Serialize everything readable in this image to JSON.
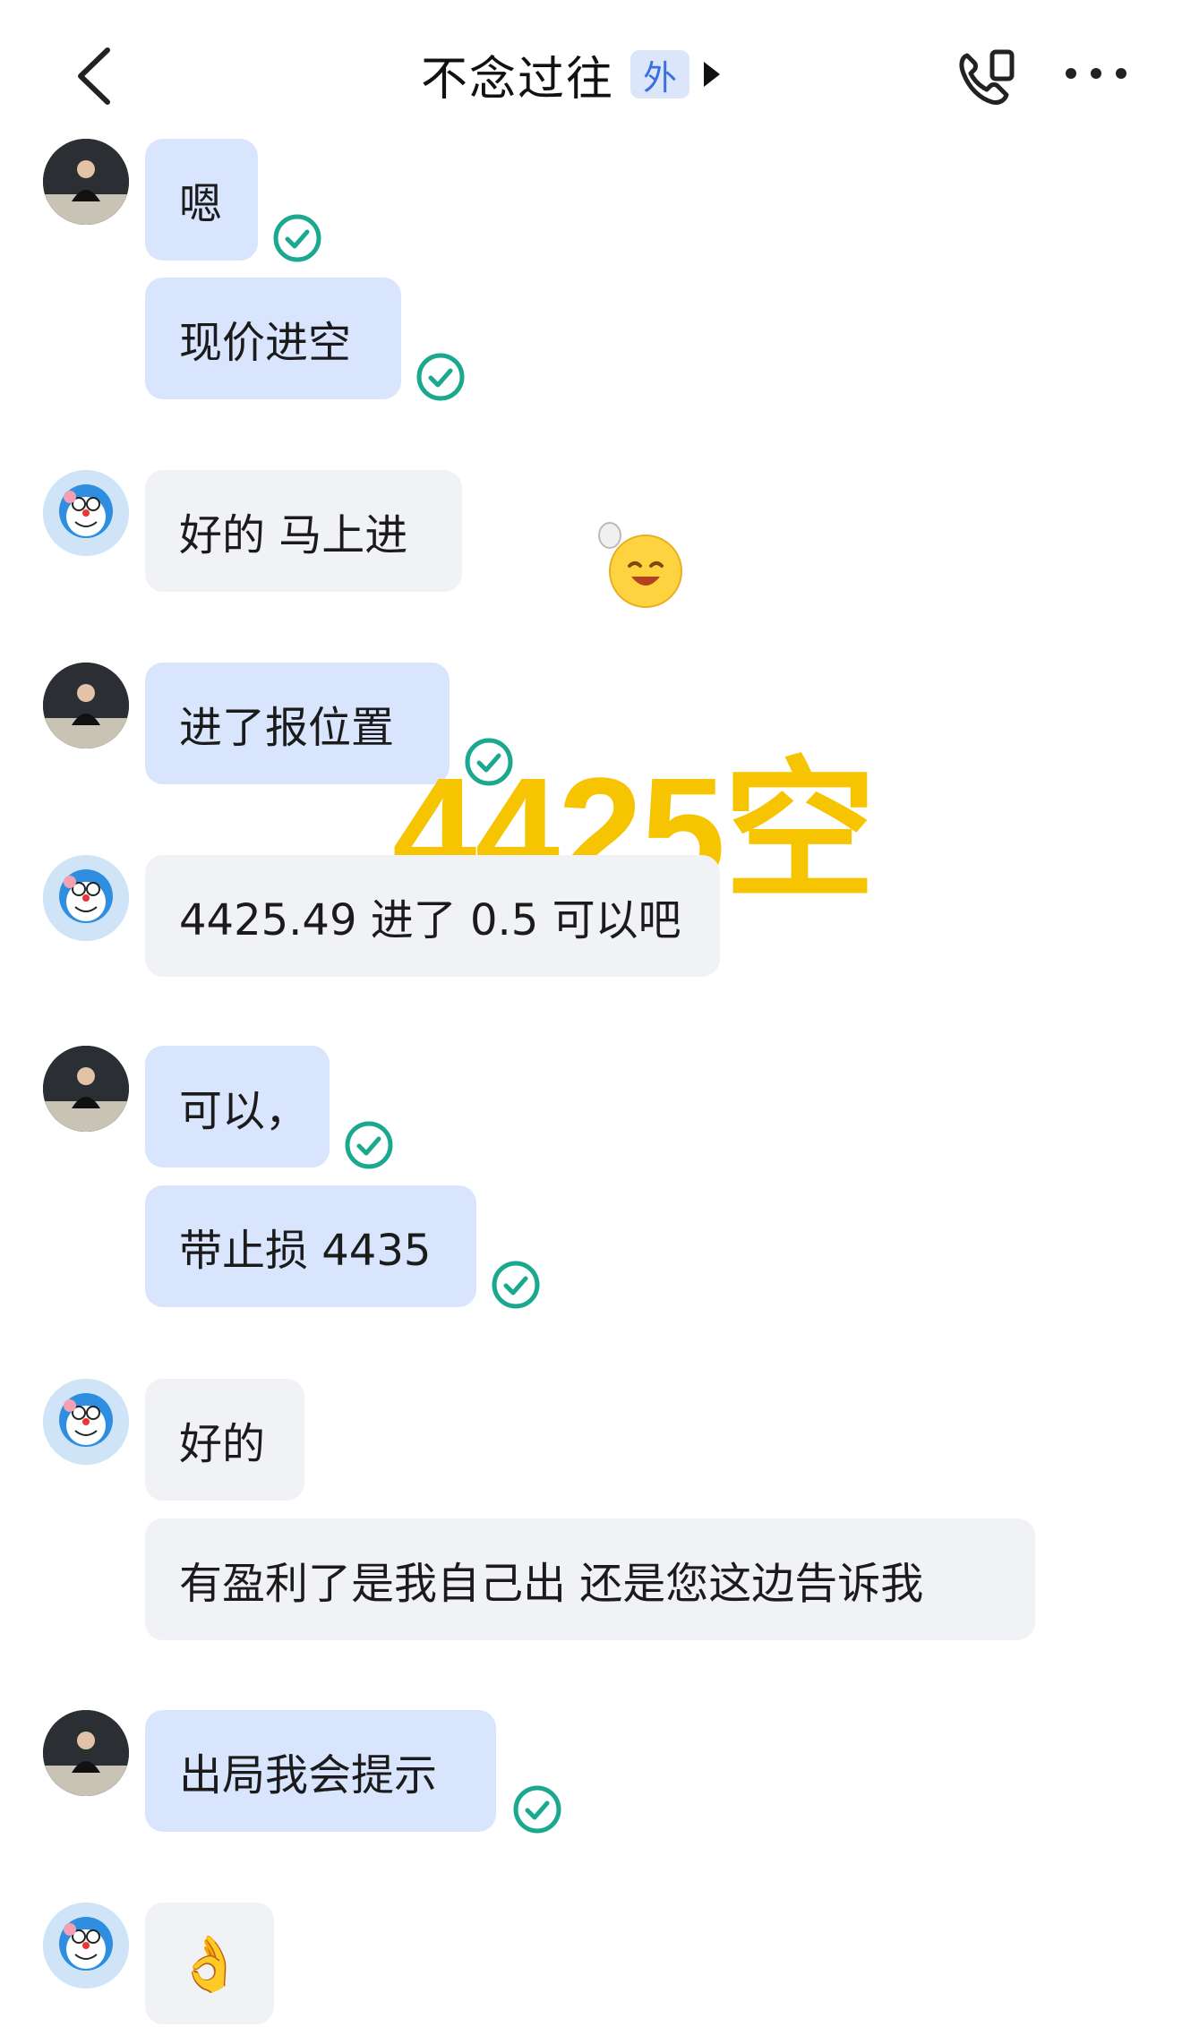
{
  "header": {
    "title": "不念过往",
    "badge": "外"
  },
  "messages": [
    {
      "sender": "self",
      "text": "嗯",
      "read": true
    },
    {
      "sender": "self",
      "text": "现价进空",
      "read": true
    },
    {
      "sender": "other",
      "text": "好的 马上进",
      "read": false
    },
    {
      "sender": "self",
      "text": "进了报位置",
      "read": true
    },
    {
      "sender": "other",
      "text": "4425.49 进了 0.5 可以吧",
      "read": false
    },
    {
      "sender": "self",
      "text": "可以，",
      "read": true
    },
    {
      "sender": "self",
      "text": "带止损 4435",
      "read": true
    },
    {
      "sender": "other",
      "text": "好的",
      "read": false
    },
    {
      "sender": "other",
      "text": "有盈利了是我自己出 还是您这边告诉我",
      "read": false
    },
    {
      "sender": "self",
      "text": "出局我会提示",
      "read": true
    },
    {
      "sender": "other",
      "text": "👌",
      "read": false
    }
  ],
  "overlay": {
    "text": "4425空"
  },
  "colors": {
    "self_bubble": "#d8e5fd",
    "other_bubble": "#f0f2f5",
    "read_check": "#1aa88f",
    "overlay": "#f6c400"
  }
}
